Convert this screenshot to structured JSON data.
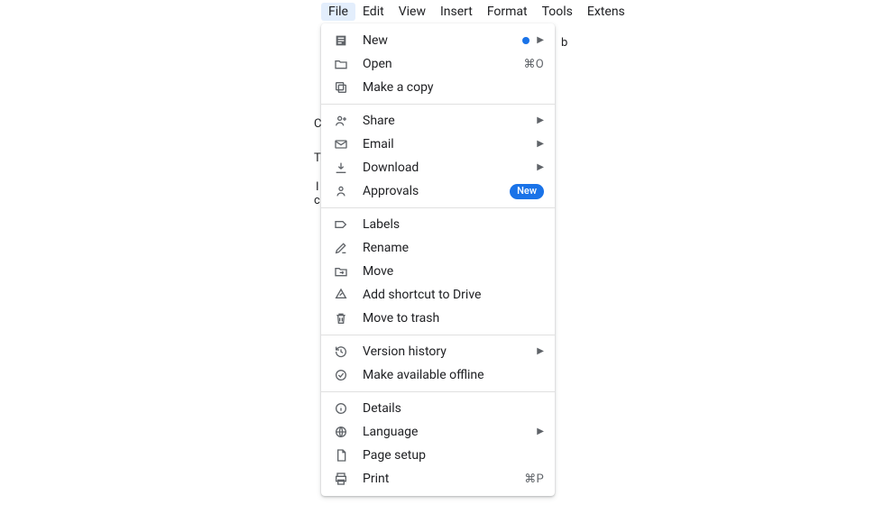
{
  "menubar": {
    "items": [
      "File",
      "Edit",
      "View",
      "Insert",
      "Format",
      "Tools",
      "Extens"
    ]
  },
  "menu": {
    "new": "New",
    "open": "Open",
    "open_shortcut": "⌘O",
    "make_copy": "Make a copy",
    "share": "Share",
    "email": "Email",
    "download": "Download",
    "approvals": "Approvals",
    "approvals_badge": "New",
    "labels": "Labels",
    "rename": "Rename",
    "move": "Move",
    "add_shortcut": "Add shortcut to Drive",
    "trash": "Move to trash",
    "version_history": "Version history",
    "offline": "Make available offline",
    "details": "Details",
    "language": "Language",
    "page_setup": "Page setup",
    "print": "Print",
    "print_shortcut": "⌘P"
  },
  "bg": {
    "c1": "C",
    "c2": "T",
    "c3": "I",
    "c4": "c",
    "c5": "b"
  }
}
